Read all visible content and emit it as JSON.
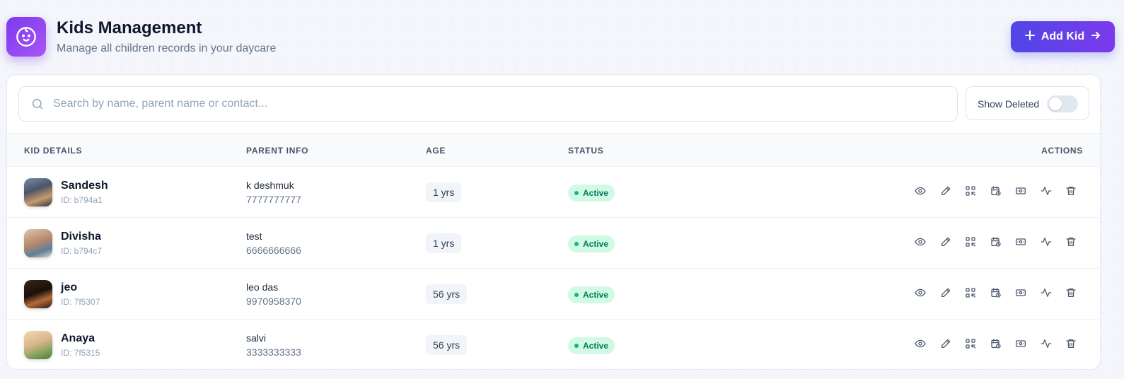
{
  "header": {
    "title": "Kids Management",
    "subtitle": "Manage all children records in your daycare",
    "logo_icon": "baby-face-icon",
    "add_button": {
      "icon": "plus-icon",
      "label": "Add Kid",
      "trailing_icon": "arrow-right-icon"
    }
  },
  "search": {
    "placeholder": "Search by name, parent name or contact...",
    "value": "",
    "icon": "search-icon"
  },
  "filters": {
    "show_deleted_label": "Show Deleted",
    "show_deleted": false
  },
  "table": {
    "columns": [
      "KID DETAILS",
      "PARENT INFO",
      "AGE",
      "STATUS",
      "ACTIONS"
    ],
    "action_icons": [
      "eye-icon",
      "pencil-icon",
      "qr-code-icon",
      "calendar-clock-icon",
      "banknote-icon",
      "activity-icon",
      "trash-icon"
    ],
    "rows": [
      {
        "name": "Sandesh",
        "id": "ID: b794a1",
        "parent_name": "k deshmuk",
        "parent_contact": "7777777777",
        "age": "1 yrs",
        "status": "Active"
      },
      {
        "name": "Divisha",
        "id": "ID: b794c7",
        "parent_name": "test",
        "parent_contact": "6666666666",
        "age": "1 yrs",
        "status": "Active"
      },
      {
        "name": "jeo",
        "id": "ID: 7f5307",
        "parent_name": "leo das",
        "parent_contact": "9970958370",
        "age": "56 yrs",
        "status": "Active"
      },
      {
        "name": "Anaya",
        "id": "ID: 7f5315",
        "parent_name": "salvi",
        "parent_contact": "3333333333",
        "age": "56 yrs",
        "status": "Active"
      }
    ]
  },
  "colors": {
    "accent": "#7c3aed",
    "button_gradient_start": "#4f46e5",
    "button_gradient_end": "#7c3aed",
    "status_active_bg": "#d1fae5",
    "status_active_text": "#047857"
  }
}
